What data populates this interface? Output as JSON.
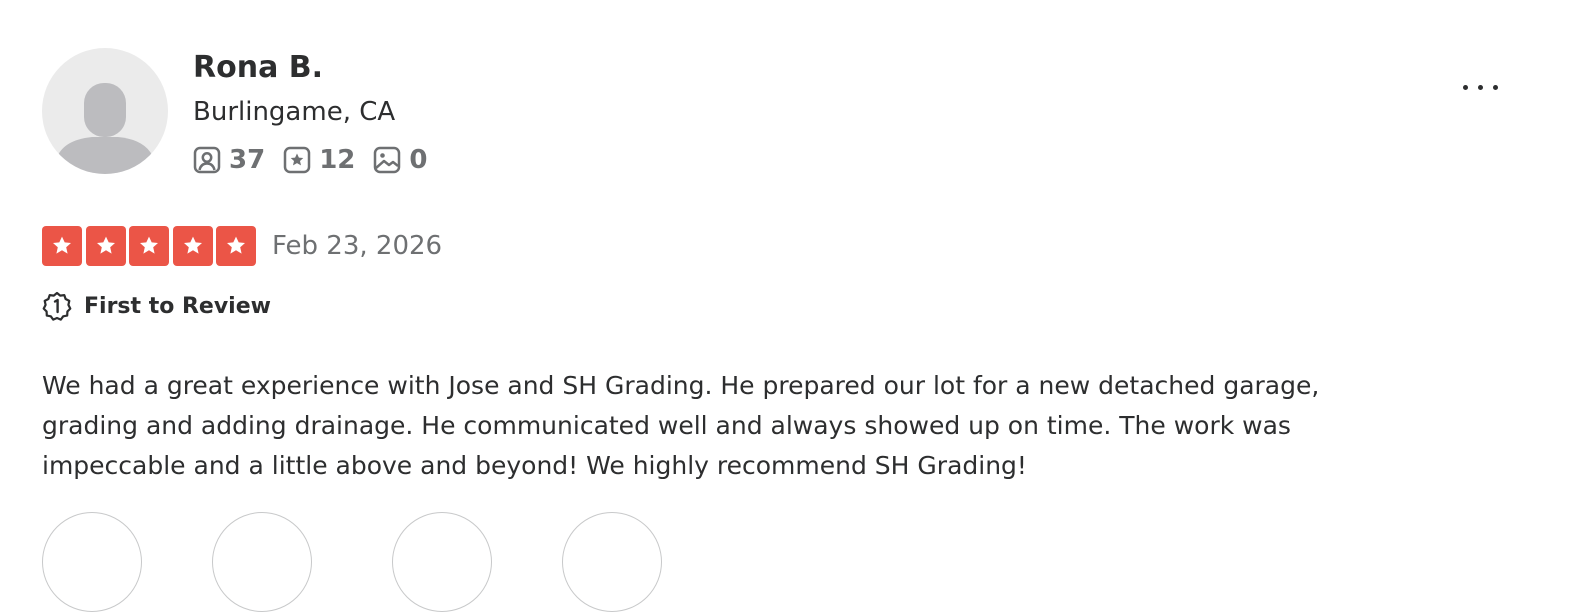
{
  "user": {
    "name": "Rona B.",
    "location": "Burlingame, CA",
    "stats": {
      "friends": "37",
      "reviews": "12",
      "photos": "0"
    }
  },
  "review": {
    "rating": 5,
    "rating_max": 5,
    "date": "Feb 23, 2026",
    "badge": "First to Review",
    "text": "We had a great experience with Jose and SH Grading. He prepared our lot for a new detached garage, grading and adding drainage. He communicated well and always showed up on time. The work was impeccable and a little above and beyond! We highly recommend SH Grading!"
  },
  "colors": {
    "star_filled": "#eb5547",
    "star_empty": "#e6e6e6",
    "text_primary": "#2d2e2f",
    "text_secondary": "#6e7072",
    "avatar_bg": "#ebebeb",
    "avatar_figure": "#bcbcbf"
  },
  "icons": {
    "avatar": "default-user-icon",
    "friends": "friends-icon",
    "reviews": "review-star-icon",
    "photos": "photo-icon",
    "badge": "first-to-review-icon",
    "more": "more-options-icon"
  }
}
